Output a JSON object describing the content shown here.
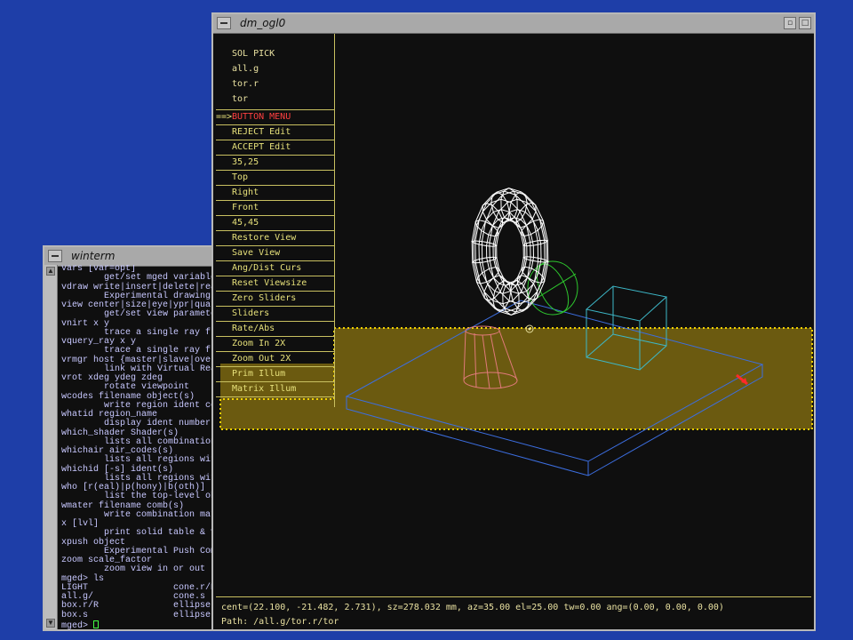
{
  "winterm": {
    "title": "winterm",
    "lines": [
      "vars [var=opt]",
      "        get/set mged variables",
      "vdraw write|insert|delete|read|",
      "        Experimental drawing (cn",
      "view center|size|eye|ypr|quat|a",
      "        get/set view parameters",
      "vnirt x y",
      "        trace a single ray from",
      "vquery_ray x y",
      "        trace a single ray from",
      "vrmgr host {master|slave|overvi",
      "        link with Virtual Reali",
      "vrot xdeg ydeg zdeg",
      "        rotate viewpoint",
      "wcodes filename object(s)",
      "        write region ident codes",
      "whatid region_name",
      "        display ident number fo",
      "which_shader Shader(s)",
      "        lists all combinations",
      "whichair air_codes(s)",
      "        lists all regions with",
      "whichid [-s] ident(s)",
      "        lists all regions with",
      "who [r(eal)|p(hony)|b(oth)]",
      "        list the top-level objec",
      "wmater filename comb(s)",
      "        write combination mater",
      "x [lvl]",
      "        print solid table & vect",
      "xpush object",
      "        Experimental Push Comman",
      "zoom scale_factor",
      "        zoom view in or out",
      "mged> ls",
      "LIGHT                cone.r/R",
      "all.g/               cone.s",
      "box.r/R              ellipse.r/R",
      "box.s                ellipse.s"
    ],
    "prompt": "mged> "
  },
  "dm": {
    "title": "dm_ogl0",
    "header": [
      "SOL PICK",
      "all.g",
      "tor.r",
      "tor"
    ],
    "pointer": "==>",
    "menu_items": [
      {
        "label": "BUTTON MENU",
        "name": "button-menu",
        "current": true
      },
      {
        "label": "REJECT Edit",
        "name": "reject-edit"
      },
      {
        "label": "ACCEPT Edit",
        "name": "accept-edit"
      },
      {
        "label": "35,25",
        "name": "view-35-25"
      },
      {
        "label": "Top",
        "name": "view-top"
      },
      {
        "label": "Right",
        "name": "view-right"
      },
      {
        "label": "Front",
        "name": "view-front"
      },
      {
        "label": "45,45",
        "name": "view-45-45"
      },
      {
        "label": "Restore View",
        "name": "restore-view"
      },
      {
        "label": "Save View",
        "name": "save-view"
      },
      {
        "label": "Ang/Dist Curs",
        "name": "ang-dist-curs"
      },
      {
        "label": "Reset Viewsize",
        "name": "reset-viewsize"
      },
      {
        "label": "Zero Sliders",
        "name": "zero-sliders"
      },
      {
        "label": "Sliders",
        "name": "sliders"
      },
      {
        "label": "Rate/Abs",
        "name": "rate-abs"
      },
      {
        "label": "Zoom In 2X",
        "name": "zoom-in-2x"
      },
      {
        "label": "Zoom Out 2X",
        "name": "zoom-out-2x"
      },
      {
        "label": "Prim Illum",
        "name": "prim-illum"
      },
      {
        "label": "Matrix Illum",
        "name": "matrix-illum"
      }
    ],
    "status_line1": "cent=(22.100, -21.482, 2.731), sz=278.032 mm, az=35.00 el=25.00 tw=0.00 ang=(0.00, 0.00, 0.00)",
    "status_line2": "Path: /all.g/tor.r/tor",
    "colors": {
      "menu_text": "#e6e07a",
      "current_item": "#ff4040",
      "highlight": "#6b5a10",
      "torus": "#ffffff",
      "box": "#3db8c8",
      "slab": "#3c6ee0",
      "cone": "#e07a7a",
      "ellipse": "#2ec82e"
    }
  }
}
